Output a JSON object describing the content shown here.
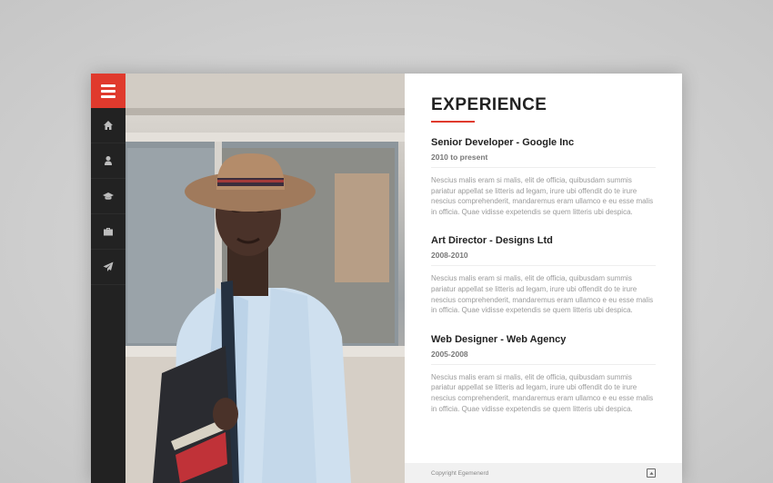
{
  "sidebar": {
    "menu_icon": "hamburger-menu-icon",
    "items": [
      {
        "icon": "home-icon"
      },
      {
        "icon": "user-icon"
      },
      {
        "icon": "graduation-cap-icon"
      },
      {
        "icon": "briefcase-icon"
      },
      {
        "icon": "paper-plane-icon"
      }
    ]
  },
  "colors": {
    "accent": "#e03a2d",
    "sidebar": "#222222"
  },
  "section": {
    "title": "EXPERIENCE"
  },
  "jobs": [
    {
      "title": "Senior Developer - Google Inc",
      "period": "2010 to present",
      "description": "Nescius malis eram si malis, elit de officia, quibusdam summis pariatur appellat se litteris ad legam, irure ubi offendit do te irure nescius comprehenderit, mandaremus eram ullamco e eu esse malis in officia. Quae vidisse expetendis se quem litteris ubi despica."
    },
    {
      "title": "Art Director - Designs Ltd",
      "period": "2008-2010",
      "description": "Nescius malis eram si malis, elit de officia, quibusdam summis pariatur appellat se litteris ad legam, irure ubi offendit do te irure nescius comprehenderit, mandaremus eram ullamco e eu esse malis in officia. Quae vidisse expetendis se quem litteris ubi despica."
    },
    {
      "title": "Web Designer - Web Agency",
      "period": "2005-2008",
      "description": "Nescius malis eram si malis, elit de officia, quibusdam summis pariatur appellat se litteris ad legam, irure ubi offendit do te irure nescius comprehenderit, mandaremus eram ullamco e eu esse malis in officia. Quae vidisse expetendis se quem litteris ubi despica."
    }
  ],
  "footer": {
    "copyright": "Copyright Egemenerd",
    "scroll_icon": "scroll-top-icon"
  }
}
